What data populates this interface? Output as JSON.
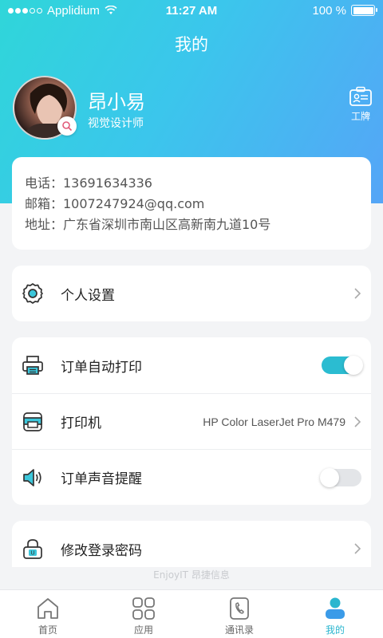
{
  "status_bar": {
    "carrier": "Applidium",
    "time": "11:27 AM",
    "battery": "100 %"
  },
  "header": {
    "title": "我的"
  },
  "profile": {
    "name": "昂小易",
    "role": "视觉设计师",
    "badge_label": "工牌"
  },
  "contact": {
    "phone": "电话：13691634336",
    "email": "邮箱：1007247924@qq.com",
    "address": "地址：广东省深圳市南山区高新南九道10号"
  },
  "settings": {
    "personal_settings": "个人设置",
    "auto_print": "订单自动打印",
    "auto_print_on": true,
    "printer": "打印机",
    "printer_value": "HP Color LaserJet Pro M479",
    "sound_alert": "订单声音提醒",
    "sound_alert_on": false,
    "change_password": "修改登录密码"
  },
  "footer": {
    "brand": "EnjoyIT 昂捷信息"
  },
  "tabs": [
    {
      "label": "首页",
      "icon": "home-icon"
    },
    {
      "label": "应用",
      "icon": "apps-icon"
    },
    {
      "label": "通讯录",
      "icon": "contacts-icon"
    },
    {
      "label": "我的",
      "icon": "profile-icon",
      "active": true
    }
  ],
  "colors": {
    "accent": "#2ab6cf",
    "gradient_start": "#2fd6d9",
    "gradient_end": "#55a5f7"
  }
}
